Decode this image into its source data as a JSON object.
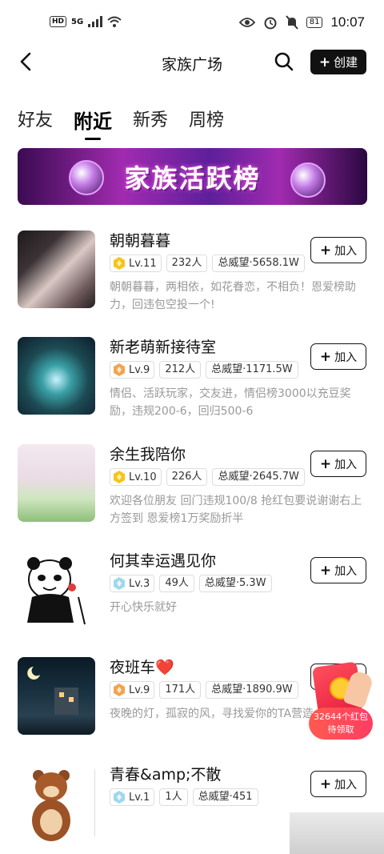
{
  "status_bar": {
    "hd": "HD",
    "network": "5G",
    "battery": "81",
    "time": "10:07"
  },
  "header": {
    "title": "家族广场",
    "create_label": "创建"
  },
  "tabs": [
    {
      "label": "好友"
    },
    {
      "label": "附近"
    },
    {
      "label": "新秀"
    },
    {
      "label": "周榜"
    }
  ],
  "banner": {
    "text": "家族活跃榜"
  },
  "families": [
    {
      "name": "朝朝暮暮",
      "level": "Lv.11",
      "members": "232人",
      "prestige": "总威望·5658.1W",
      "desc": "朝朝暮暮，两相依，如花眷恋，不相负！恩爱榜助力，回违包空投一个!",
      "join": "加入",
      "badge_color": "#f5c518"
    },
    {
      "name": "新老萌新接待室",
      "level": "Lv.9",
      "members": "212人",
      "prestige": "总威望·1171.5W",
      "desc": "情侣、活跃玩家，交友进，情侣榜3000以充豆奖励，违规200-6，回归500-6",
      "join": "加入",
      "badge_color": "#f0a550"
    },
    {
      "name": "余生我陪你",
      "level": "Lv.10",
      "members": "226人",
      "prestige": "总威望·2645.7W",
      "desc": "欢迎各位朋友 回门违规100/8 抢红包要说谢谢右上方签到 恩爱榜1万奖励折半",
      "join": "加入",
      "badge_color": "#f5c518"
    },
    {
      "name": "何其幸运遇见你",
      "level": "Lv.3",
      "members": "49人",
      "prestige": "总威望·5.3W",
      "desc": "开心快乐就好",
      "join": "加入",
      "badge_color": "#9fd8ee"
    },
    {
      "name": "夜班车❤️",
      "level": "Lv.9",
      "members": "171人",
      "prestige": "总威望·1890.9W",
      "desc": "夜晚的灯，孤寂的风，寻找爱你的TA营造大家庭",
      "join": "加入",
      "badge_color": "#f0a550"
    },
    {
      "name": "青春&amp;不散",
      "level": "Lv.1",
      "members": "1人",
      "prestige": "总威望·451",
      "desc": "",
      "join": "加入",
      "badge_color": "#9fd8ee"
    }
  ],
  "red_packet": {
    "line1": "32644个红包",
    "line2": "待领取"
  }
}
